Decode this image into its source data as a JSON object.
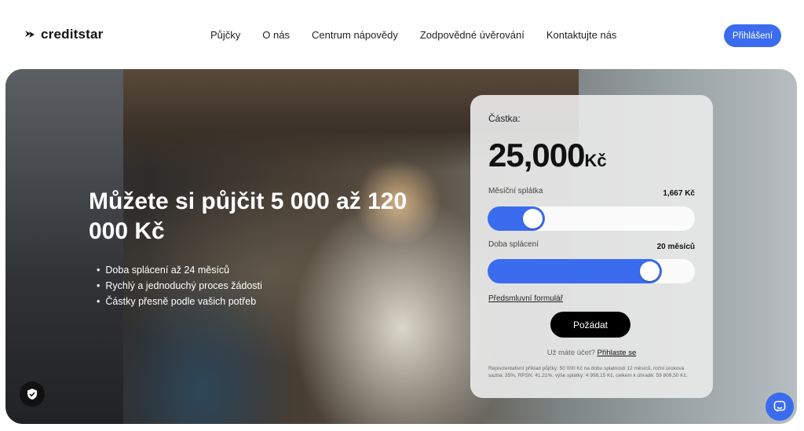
{
  "brand": {
    "name": "creditstar"
  },
  "nav": {
    "items": [
      "Půjčky",
      "O nás",
      "Centrum nápovědy",
      "Zodpovědné úvěrování",
      "Kontaktujte nás"
    ]
  },
  "header": {
    "login_label": "Přihlášení"
  },
  "hero": {
    "title": "Můžete si půjčit 5 000 až 120 000 Kč",
    "bullets": [
      "Doba splácení až 24 měsíců",
      "Rychlý a jednoduchý proces žádosti",
      "Částky přesně podle vašich potřeb"
    ]
  },
  "calculator": {
    "amount_label": "Částka:",
    "amount_value": "25,000",
    "amount_currency": "Kč",
    "monthly_label": "Měsíční splátka",
    "monthly_value": "1,667 Kč",
    "monthly_slider_level": 0.18,
    "term_label": "Doba splácení",
    "term_value": "20 měsíců",
    "term_slider_level": 0.82,
    "contract_link": "Předsmluvní formulář",
    "apply_label": "Požádat",
    "account_text": "Už máte účet?",
    "signin_link": "Přihlaste se",
    "legal_text": "Reprezentativní příklad půjčky: 50 000 Kč na dobu splatnosti 12 měsíců, roční úroková sazba: 35%, RPSN: 41,21%, výše splátky: 4 998,15 Kč, celkem k úhradě: 59 809,50 Kč."
  },
  "colors": {
    "accent": "#3b6cf0",
    "dark": "#000000"
  },
  "icons": {
    "logo": "creditstar-logo-icon",
    "shield": "shield-check-icon",
    "chat": "chat-icon"
  }
}
